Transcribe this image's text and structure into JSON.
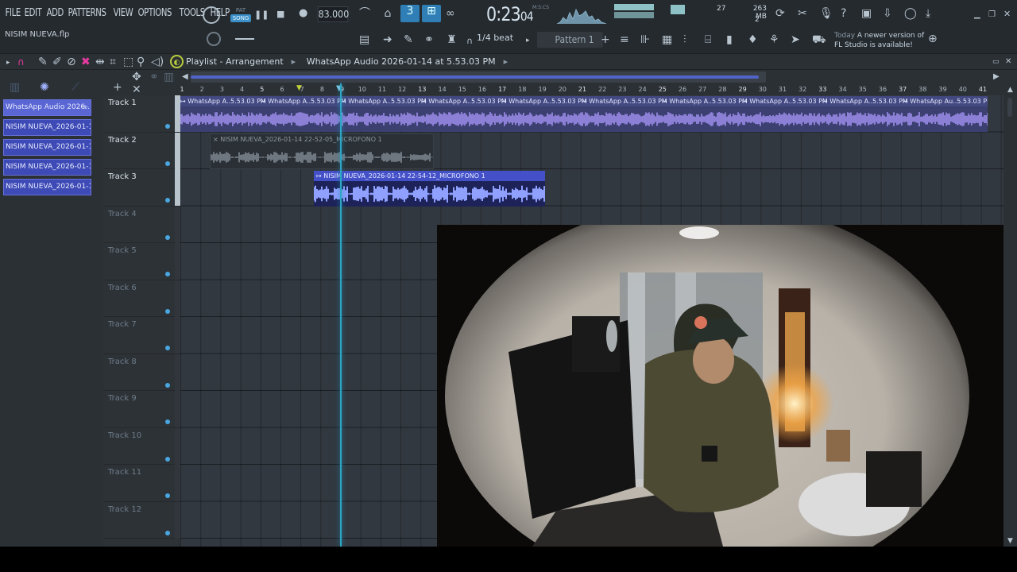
{
  "menu": [
    "FILE",
    "EDIT",
    "ADD",
    "PATTERNS",
    "VIEW",
    "OPTIONS",
    "TOOLS",
    "HELP"
  ],
  "project_name": "NISIM NUEVA.flp",
  "transport": {
    "pat_label": "PAT",
    "song_label": "SONG",
    "tempo": "83.000",
    "time": "0:23",
    "time_sub": "04",
    "time_units": "M:S:CS"
  },
  "stats": {
    "memory": "263 MB",
    "polyphony": "27",
    "cpu_count": "2"
  },
  "snap": {
    "label": "1/4 beat"
  },
  "pattern": {
    "label": "Pattern 1"
  },
  "news": {
    "today": "Today",
    "line1": "A newer version of",
    "line2": "FL Studio is available!"
  },
  "playlist": {
    "title": "Playlist - Arrangement",
    "breadcrumb": "WhatsApp Audio 2026-01-14 at 5.53.03 PM"
  },
  "clip_list": [
    "WhatsApp Audio 2026..",
    "NISIM NUEVA_2026-01-14..",
    "NISIM NUEVA_2026-01-14..",
    "NISIM NUEVA_2026-01-14..",
    "NISIM NUEVA_2026-01-14.."
  ],
  "tracks": [
    "Track 1",
    "Track 2",
    "Track 3",
    "Track 4",
    "Track 5",
    "Track 6",
    "Track 7",
    "Track 8",
    "Track 9",
    "Track 10",
    "Track 11",
    "Track 12"
  ],
  "ruler": [
    "1",
    "2",
    "3",
    "4",
    "5",
    "6",
    "7",
    "8",
    "9",
    "10",
    "11",
    "12",
    "13",
    "14",
    "15",
    "16",
    "17",
    "18",
    "19",
    "20",
    "21",
    "22",
    "23",
    "24",
    "25",
    "26",
    "27",
    "28",
    "29",
    "30",
    "31",
    "32",
    "33",
    "34",
    "35",
    "36",
    "37",
    "38",
    "39",
    "40",
    "41"
  ],
  "clips": {
    "whatsapp_label": "↦ WhatsApp A..5.53.03 PM",
    "whatsapp_last": "↦ WhatsApp Au..5.53.03 PM",
    "mic1": "× NISIM NUEVA_2026-01-14 22-52-05_MICROFONO 1",
    "mic2": "↦ NISIM NUEVA_2026-01-14 22-54-12_MICROFONO 1"
  },
  "colors": {
    "accent": "#3c8fc7",
    "clip_blue": "#4450c8",
    "playhead": "#2fa6c6"
  }
}
